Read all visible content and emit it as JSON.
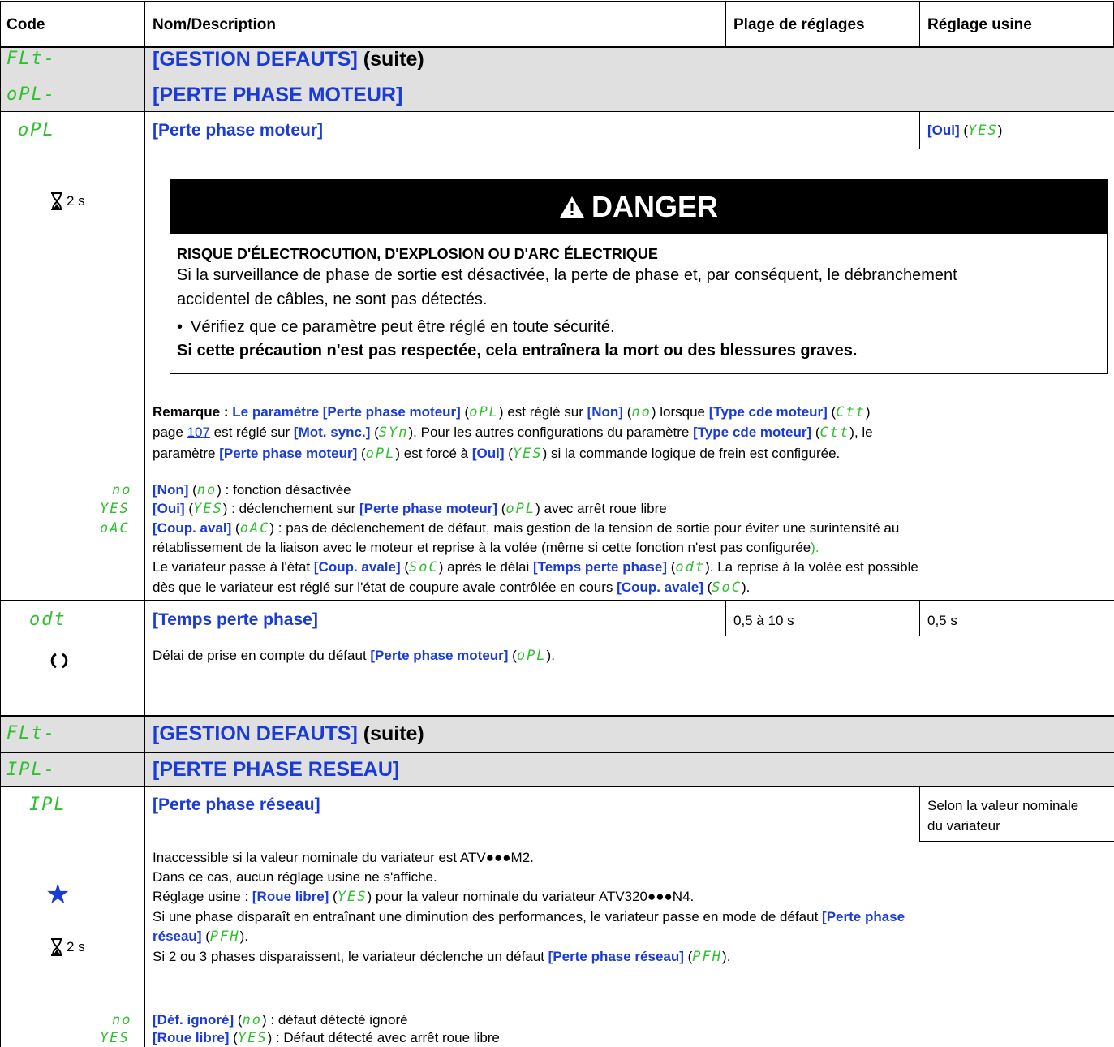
{
  "header": {
    "code": "Code",
    "name": "Nom/Description",
    "range": "Plage de réglages",
    "factory": "Réglage usine"
  },
  "section1": {
    "code": "FLt-",
    "title_bracket": "[GESTION DEFAUTS]",
    "title_suffix": " (suite)"
  },
  "subsection1": {
    "code": "oPL-",
    "title": "[PERTE PHASE MOTEUR]"
  },
  "param_opl": {
    "code": "oPL",
    "name": "[Perte phase moteur]",
    "factory_bracket": "[Oui]",
    "factory_code": "YES",
    "time": "2 s",
    "danger": {
      "title": "DANGER",
      "heading": "RISQUE D'ÉLECTROCUTION, D'EXPLOSION OU D'ARC ÉLECTRIQUE",
      "line1": "Si la surveillance de phase de sortie est désactivée, la perte de phase et, par conséquent, le débranchement",
      "line2": "accidentel de câbles, ne sont pas détectés.",
      "bullet": "Vérifiez que ce paramètre peut être réglé en toute sécurité.",
      "footer": "Si cette précaution n'est pas respectée, cela entraînera la mort ou des blessures graves."
    },
    "note": {
      "label": "Remarque :",
      "l1_a": " Le paramètre ",
      "l1_b": "[Perte phase moteur]",
      "l1_c": "oPL",
      "l1_d": " est réglé sur ",
      "l1_e": "[Non]",
      "l1_f": "no",
      "l1_g": " lorsque ",
      "l1_h": "[Type cde moteur]",
      "l1_i": "Ctt",
      "l2_a": "page ",
      "l2_link": "107",
      "l2_b": " est réglé sur ",
      "l2_c": "[Mot. sync.]",
      "l2_d": "SYn",
      "l2_e": ". Pour les autres configurations du paramètre ",
      "l2_f": "[Type cde moteur]",
      "l2_g": "Ctt",
      "l2_h": ", le",
      "l3_a": "paramètre ",
      "l3_b": "[Perte phase moteur]",
      "l3_c": "oPL",
      "l3_d": " est forcé à ",
      "l3_e": "[Oui]",
      "l3_f": "YES",
      "l3_g": " si la commande logique de frein est configurée."
    },
    "options": [
      {
        "code": "no",
        "bracket": "[Non]",
        "paren": "no",
        "text": " : fonction désactivée"
      },
      {
        "code": "YES",
        "bracket": "[Oui]",
        "paren": "YES",
        "text": " : déclenchement sur ",
        "b2": "[Perte phase moteur]",
        "p2": "oPL",
        "text2": " avec arrêt roue libre"
      },
      {
        "code": "oAC",
        "bracket": "[Coup. aval]",
        "paren": "oAC",
        "text": " : pas de déclenchement de défaut, mais gestion de la tension de sortie pour éviter une surintensité au"
      }
    ],
    "opt3_l2": "rétablissement de la liaison avec le moteur et reprise à la volée (même si cette fonction n'est pas configurée",
    "opt3_l2_end": ").",
    "opt3_l3_a": "Le variateur passe à l'état ",
    "opt3_l3_b": "[Coup. avale]",
    "opt3_l3_c": "SoC",
    "opt3_l3_d": " après le délai ",
    "opt3_l3_e": "[Temps perte phase]",
    "opt3_l3_f": "odt",
    "opt3_l3_g": ". La reprise à la volée est possible",
    "opt3_l4_a": "dès que le variateur est réglé sur l'état de coupure avale contrôlée en cours ",
    "opt3_l4_b": "[Coup. avale]",
    "opt3_l4_c": "SoC",
    "opt3_l4_d": "."
  },
  "param_odt": {
    "code": "odt",
    "name": "[Temps perte phase]",
    "range": "0,5 à 10 s",
    "factory": "0,5 s",
    "desc_a": "Délai de prise en compte du défaut ",
    "desc_b": "[Perte phase moteur]",
    "desc_c": "oPL",
    "desc_d": "."
  },
  "section2": {
    "code": "FLt-",
    "title_bracket": "[GESTION DEFAUTS]",
    "title_suffix": " (suite)"
  },
  "subsection2": {
    "code": "IPL-",
    "title": "[PERTE PHASE RESEAU]"
  },
  "param_ipl": {
    "code": "IPL",
    "name": "[Perte phase réseau]",
    "factory_l1": "Selon la valeur nominale",
    "factory_l2": "du variateur",
    "time": "2 s",
    "d1": "Inaccessible si la valeur nominale du variateur est ATV●●●M2.",
    "d2": "Dans ce cas, aucun réglage usine ne s'affiche.",
    "d3_a": "Réglage usine : ",
    "d3_b": "[Roue libre]",
    "d3_c": "YES",
    "d3_d": " pour la valeur nominale du variateur ATV320●●●N4.",
    "d4_a": "Si une phase disparaît en entraînant une diminution des performances, le variateur passe en mode de défaut ",
    "d4_b": "[Perte phase",
    "d5_a": "réseau]",
    "d5_b": "PFH",
    "d5_c": ".",
    "d6_a": "Si 2 ou 3 phases disparaissent, le variateur déclenche un défaut ",
    "d6_b": "[Perte phase réseau]",
    "d6_c": "PFH",
    "d6_d": ".",
    "options": [
      {
        "code": "no",
        "bracket": "[Déf. ignoré]",
        "paren": "no",
        "text": " : défaut détecté ignoré"
      },
      {
        "code": "YES",
        "bracket": "[Roue libre]",
        "paren": "YES",
        "text": " : Défaut détecté avec arrêt roue libre"
      }
    ]
  },
  "colors": {
    "band": "#e0e0e0",
    "blue": "#1a3bd6",
    "green": "#2fbf2f"
  }
}
